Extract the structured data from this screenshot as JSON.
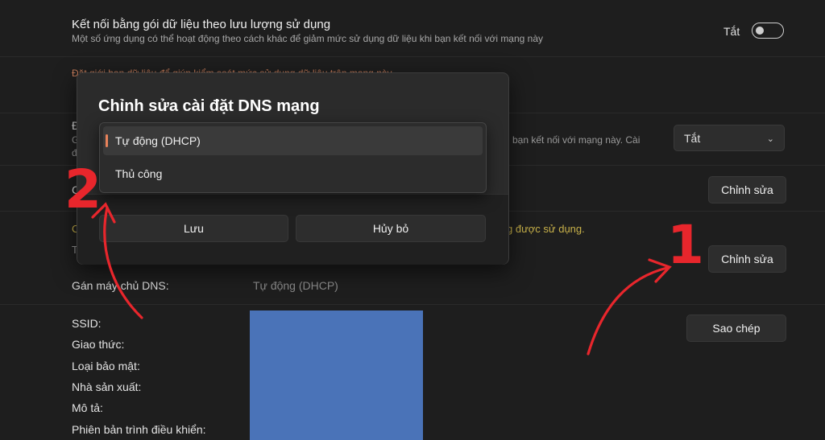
{
  "settings": {
    "metered": {
      "title": "Kết nối bằng gói dữ liệu theo lưu lượng sử dụng",
      "description": "Một số ứng dụng có thể hoạt động theo cách khác để giảm mức sử dụng dữ liệu khi bạn kết nối với mạng này",
      "toggle_label": "Tắt",
      "toggle_on": false
    },
    "data_limit_link": "Đặt giới hạn dữ liệu để giúp kiểm soát mức sử dụng dữ liệu trên mạng này",
    "partial_lines": {
      "line1_left": "Đ",
      "line2_left": "G",
      "line2_right": "i bạn kết nối với mạng này. Cài",
      "line3_left": "đ",
      "ip_left": "C",
      "note_left": "C",
      "note_left2": "T"
    },
    "privacy_dropdown": {
      "value": "Tắt"
    },
    "edit_button_1": "Chỉnh sửa",
    "edit_button_2": "Chỉnh sửa",
    "dns_note": "g được sử dụng.",
    "dns_assign": {
      "label": "Gán máy chủ DNS:",
      "value": "Tự động (DHCP)"
    },
    "copy_button": "Sao chép",
    "properties": [
      "SSID:",
      "Giao thức:",
      "Loại bảo mật:",
      "Nhà sản xuất:",
      "Mô tả:",
      "Phiên bản trình điều khiển:"
    ],
    "colors": {
      "accent": "#e8825a",
      "link_orange": "#c77d5b",
      "note_yellow": "#c9b24a",
      "redacted_block": "#4a73b8",
      "annotation_red": "#e8262c"
    }
  },
  "dialog": {
    "title": "Chỉnh sửa cài đặt DNS mạng",
    "options": [
      {
        "label": "Tự động (DHCP)",
        "selected": true
      },
      {
        "label": "Thủ công",
        "selected": false
      }
    ],
    "save_label": "Lưu",
    "cancel_label": "Hủy bỏ"
  },
  "annotations": {
    "step1": "1",
    "step2": "2"
  }
}
